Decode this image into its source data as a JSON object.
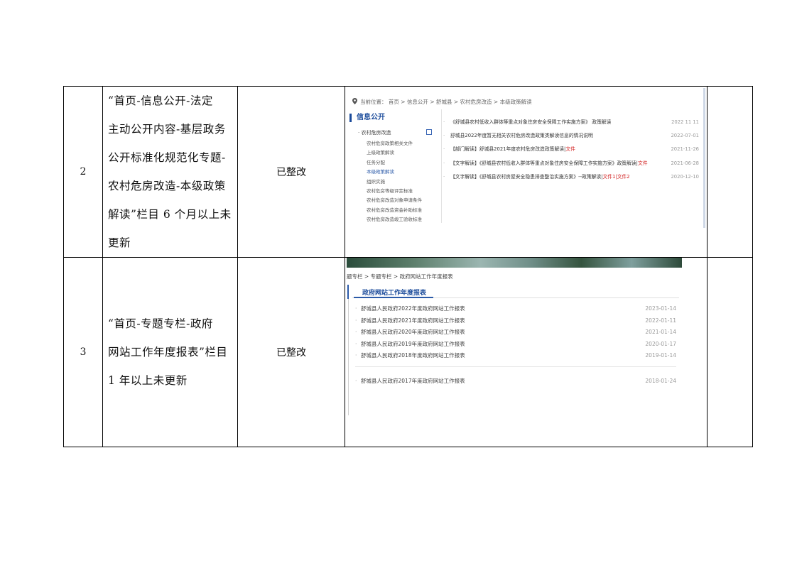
{
  "rows": [
    {
      "num": "2",
      "desc_lines": [
        "“首页-信息公开-法定",
        "主动公开内容-基层政务",
        "公开标准化规范化专题-",
        "农村危房改造-本级政策",
        "解读”栏目 6 个月以上未",
        "更新"
      ],
      "status": "已整改"
    },
    {
      "num": "3",
      "desc_lines": [
        "“首页-专题专栏-政府",
        "网站工作年度报表”栏目",
        "1 年以上未更新"
      ],
      "status": "已整改"
    }
  ],
  "shot1": {
    "breadcrumb": "当前位置： 首页 > 信息公开 > 舒城县 > 农村危房改造 > 本级政策解读",
    "sidebar_title": "信息公开",
    "sidebar_category": "· 农村危房改造",
    "sidebar_items": [
      "农村危房政策相关文件",
      "上级政策解读",
      "任务分配",
      "本级政策解读",
      "组织实施",
      "农村危房等级评定标准",
      "农村危房改造对象申请条件",
      "农村危房改造资金补助标准",
      "农村危房改造竣工验收标准"
    ],
    "sidebar_selected_index": 3,
    "news": [
      {
        "title": "《舒城县农村低收入群体等重点对象住房安全保障工作实施方案》  政策解读",
        "red": "",
        "date": "2022 11 11"
      },
      {
        "title": "舒城县2022年度暂无相关农村危房改造政策类解读信息的情况说明",
        "red": "",
        "date": "2022-07-01"
      },
      {
        "title": "【部门解读】舒城县2021年度农村危房改造政策解读|",
        "red": "文件",
        "date": "2021-11-26"
      },
      {
        "title": "【文字解读】《舒城县农村低收入群体等重点对象住房安全保障工作实施方案》政策解读|",
        "red": "文件",
        "date": "2021-06-28"
      },
      {
        "title": "【文字解读】《舒城县农村房屋安全隐患排查整治实施方案》--政策解读|",
        "red": "文件1|文件2",
        "date": "2020-12-10"
      }
    ]
  },
  "shot2": {
    "breadcrumb": "题专栏 > 专题专栏 > 政府网站工作年度报表",
    "heading": "政府网站工作年度报表",
    "reports": [
      {
        "title": "舒城县人民政府2022年度政府网站工作报表",
        "date": "2023-01-14"
      },
      {
        "title": "舒城县人民政府2021年度政府网站工作报表",
        "date": "2022-01-11"
      },
      {
        "title": "舒城县人民政府2020年度政府网站工作报表",
        "date": "2021-01-14"
      },
      {
        "title": "舒城县人民政府2019年度政府网站工作报表",
        "date": "2020-01-17"
      },
      {
        "title": "舒城县人民政府2018年度政府网站工作报表",
        "date": "2019-01-14"
      }
    ],
    "reports_more": [
      {
        "title": "舒城县人民政府2017年度政府网站工作报表",
        "date": "2018-01-24"
      }
    ]
  },
  "colors": {
    "link_blue": "#1b4b9b",
    "red": "#d21f1f"
  }
}
